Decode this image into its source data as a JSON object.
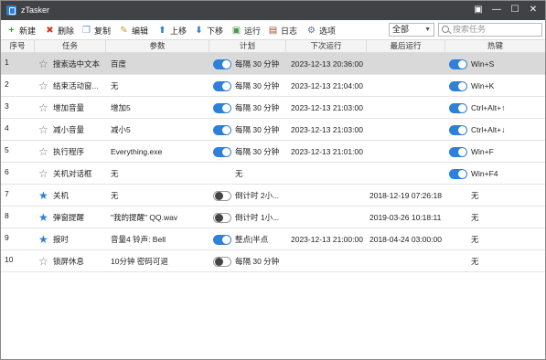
{
  "app": {
    "title": "zTasker"
  },
  "window_controls": {
    "restore": "▣",
    "minimize": "—",
    "maximize": "☐",
    "close": "✕"
  },
  "toolbar": {
    "new": "新建",
    "delete": "删除",
    "copy": "复制",
    "edit": "编辑",
    "move_up": "上移",
    "move_down": "下移",
    "run": "运行",
    "log": "日志",
    "options": "选项"
  },
  "filter": {
    "value": "全部"
  },
  "search": {
    "placeholder": "搜索任务"
  },
  "columns": [
    "序号",
    "任务",
    "参数",
    "计划",
    "下次运行",
    "最后运行",
    "热键"
  ],
  "rows": [
    {
      "index": "1",
      "starred": false,
      "task": "搜索选中文本",
      "param": "百度",
      "plan_on": true,
      "plan": "每隔 30 分钟",
      "next": "2023-12-13 20:36:00",
      "last": "",
      "hotkey_on": true,
      "hotkey": "Win+S",
      "selected": true
    },
    {
      "index": "2",
      "starred": false,
      "task": "结束活动窗...",
      "param": "无",
      "plan_on": true,
      "plan": "每隔 30 分钟",
      "next": "2023-12-13 21:04:00",
      "last": "",
      "hotkey_on": true,
      "hotkey": "Win+K",
      "selected": false
    },
    {
      "index": "3",
      "starred": false,
      "task": "增加音量",
      "param": "增加5",
      "plan_on": true,
      "plan": "每隔 30 分钟",
      "next": "2023-12-13 21:03:00",
      "last": "",
      "hotkey_on": true,
      "hotkey": "Ctrl+Alt+↑",
      "selected": false
    },
    {
      "index": "4",
      "starred": false,
      "task": "减小音量",
      "param": "减小5",
      "plan_on": true,
      "plan": "每隔 30 分钟",
      "next": "2023-12-13 21:03:00",
      "last": "",
      "hotkey_on": true,
      "hotkey": "Ctrl+Alt+↓",
      "selected": false
    },
    {
      "index": "5",
      "starred": false,
      "task": "执行程序",
      "param": "Everything.exe",
      "plan_on": true,
      "plan": "每隔 30 分钟",
      "next": "2023-12-13 21:01:00",
      "last": "",
      "hotkey_on": true,
      "hotkey": "Win+F",
      "selected": false
    },
    {
      "index": "6",
      "starred": false,
      "task": "关机对话框",
      "param": "无",
      "plan_on": null,
      "plan": "无",
      "next": "",
      "last": "",
      "hotkey_on": true,
      "hotkey": "Win+F4",
      "selected": false
    },
    {
      "index": "7",
      "starred": true,
      "task": "关机",
      "param": "无",
      "plan_on": false,
      "plan": "倒计时 2小...",
      "next": "",
      "last": "2018-12-19 07:26:18",
      "hotkey_on": null,
      "hotkey": "无",
      "selected": false
    },
    {
      "index": "8",
      "starred": true,
      "task": "弹窗提醒",
      "param": "\"我的提醒\" QQ.wav",
      "plan_on": false,
      "plan": "倒计时 1小...",
      "next": "",
      "last": "2019-03-26 10:18:11",
      "hotkey_on": null,
      "hotkey": "无",
      "selected": false
    },
    {
      "index": "9",
      "starred": true,
      "task": "报时",
      "param": "音量4 铃声: Bell",
      "plan_on": true,
      "plan": "整点|半点",
      "next": "2023-12-13 21:00:00",
      "last": "2018-04-24 03:00:00",
      "hotkey_on": null,
      "hotkey": "无",
      "selected": false
    },
    {
      "index": "10",
      "starred": false,
      "task": "锁屏休息",
      "param": "10分钟 密码可退",
      "plan_on": false,
      "plan": "每隔 30 分钟",
      "next": "",
      "last": "",
      "hotkey_on": null,
      "hotkey": "无",
      "selected": false
    }
  ],
  "colors": {
    "titlebar": "#404245",
    "accent": "#2f80d8",
    "selected_row": "#d9d9d9"
  }
}
